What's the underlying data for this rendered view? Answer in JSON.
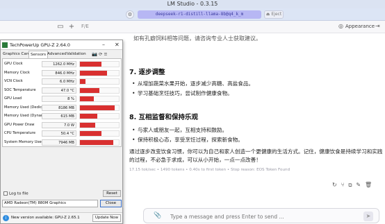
{
  "app": {
    "title": "LM Studio - 0.3.15",
    "model_name": "deepseek-r1-distill-llama-8b@q4_k_m",
    "eject_label": "Eject",
    "tab_label": "F/E",
    "appearance_label": "Appearance",
    "plus_label": "+"
  },
  "chat": {
    "cut_line": "如有孔癖饲料相等问题，请咨询专业人士获取建议。",
    "sections": [
      {
        "heading": "7. 逐步调整",
        "bullets": [
          "从增加蔬菜水果开始，逐步减少高糖、高盐食品。",
          "学习基础烹饪技巧，尝试制作健康食物。"
        ]
      },
      {
        "heading": "8. 互相监督和保持乐观",
        "bullets": [
          "与家人或朋友一起，互相支持和鼓励。",
          "保持积极心态，享受烹饪过程，探索新食物。"
        ]
      }
    ],
    "summary": "通过逐步改变饮食习惯，你可以为自己和家人创造一个更健康的生活方式。记住，健康饮食是持续学习和实践的过程，不必急于求成，可以从小开始，一点一点改善！",
    "stats": "17.15 tok/sec • 1490 tokens • 0.40s to first token • Stop reason: EOS Token Found",
    "input_placeholder": "Type a message and press Enter to send ..."
  },
  "gpuz": {
    "title": "TechPowerUp GPU-Z 2.64.0",
    "tabs": [
      "Graphics Card",
      "Sensors",
      "Advanced",
      "Validation"
    ],
    "active_tab": "Sensors",
    "sensors": [
      {
        "label": "GPU Clock",
        "value": "1262.0 MHz",
        "level": 0.55
      },
      {
        "label": "Memory Clock",
        "value": "846.0 MHz",
        "level": 0.7
      },
      {
        "label": "VCN Clock",
        "value": "6.0 MHz",
        "level": 0.15
      },
      {
        "label": "SOC Temperature",
        "value": "47.0 °C",
        "level": 0.5
      },
      {
        "label": "GPU Load",
        "value": "8 %",
        "level": 0.35
      },
      {
        "label": "Memory Used (Dedicated)",
        "value": "8186 MB",
        "level": 0.9
      },
      {
        "label": "Memory Used (Dynamic)",
        "value": "615 MB",
        "level": 0.45
      },
      {
        "label": "GPU Power Draw",
        "value": "7.0 W",
        "level": 0.4
      },
      {
        "label": "CPU Temperature",
        "value": "50.4 °C",
        "level": 0.55
      },
      {
        "label": "System Memory Used",
        "value": "7946 MB",
        "level": 0.85
      }
    ],
    "log_label": "Log to file",
    "reset_label": "Reset",
    "gpu_name": "AMD Radeon(TM) 880M Graphics",
    "close_label": "Close",
    "update_text": "New version available: GPU-Z 2.65.1",
    "update_button": "Update Now",
    "colors": {
      "graph": "#d93030",
      "accent": "#3a6fc8"
    }
  },
  "colors": {
    "titlebar": "#dbe3f2",
    "model_pill": "#b7b7f4"
  }
}
